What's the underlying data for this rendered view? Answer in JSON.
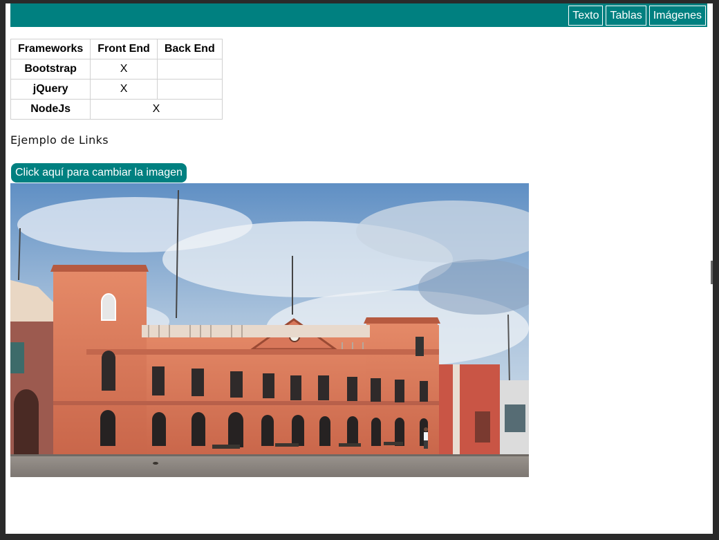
{
  "navbar": {
    "links": [
      "Texto",
      "Tablas",
      "Imágenes"
    ]
  },
  "table": {
    "headers": [
      "Frameworks",
      "Front End",
      "Back End"
    ],
    "rows": [
      {
        "name": "Bootstrap",
        "front_end": "X",
        "back_end": ""
      },
      {
        "name": "jQuery",
        "front_end": "X",
        "back_end": ""
      },
      {
        "name": "NodeJs",
        "both": "X"
      }
    ]
  },
  "links_title": "Ejemplo de Links",
  "change_image_button": "Click aquí para cambiar la imagen",
  "photo": {
    "subject": "colonial-building-photo"
  },
  "colors": {
    "accent": "#008080",
    "page_background": "#ffffff",
    "frame": "#2a2a2a"
  }
}
